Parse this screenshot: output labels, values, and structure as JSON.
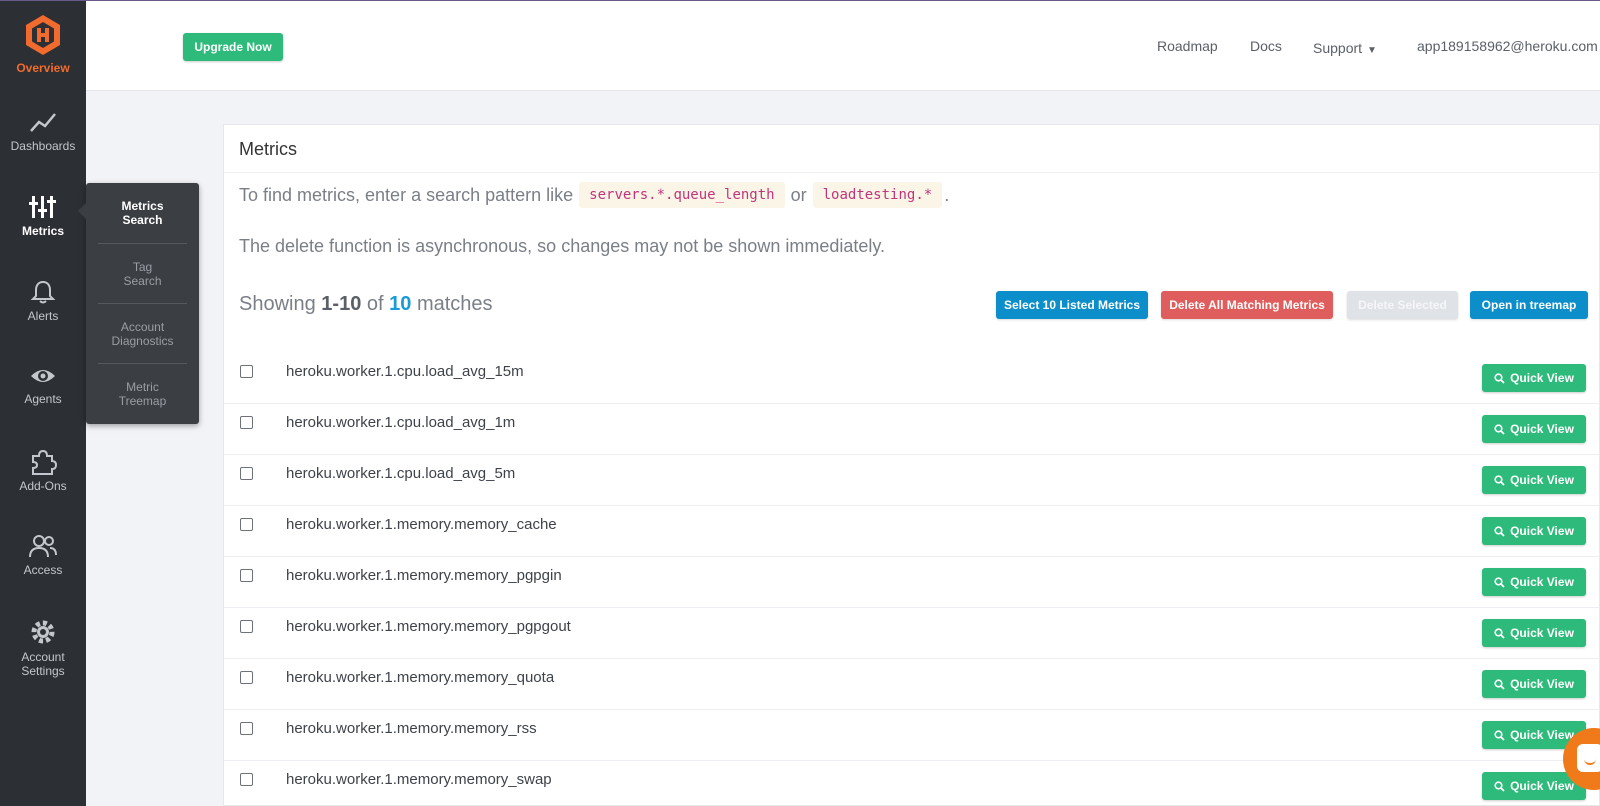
{
  "sidebar": {
    "items": [
      {
        "label": "Overview",
        "icon": "hexagon-logo-icon"
      },
      {
        "label": "Dashboards",
        "icon": "line-chart-icon"
      },
      {
        "label": "Metrics",
        "icon": "metrics-bars-icon"
      },
      {
        "label": "Alerts",
        "icon": "bell-icon"
      },
      {
        "label": "Agents",
        "icon": "eye-icon"
      },
      {
        "label": "Add-Ons",
        "icon": "puzzle-icon"
      },
      {
        "label": "Access",
        "icon": "users-icon"
      },
      {
        "label": "Account\nSettings",
        "label_lines": [
          "Account",
          "Settings"
        ],
        "icon": "gear-icon"
      }
    ]
  },
  "flyout": {
    "items": [
      {
        "lines": [
          "Metrics",
          "Search"
        ]
      },
      {
        "lines": [
          "Tag",
          "Search"
        ]
      },
      {
        "lines": [
          "Account",
          "Diagnostics"
        ]
      },
      {
        "lines": [
          "Metric",
          "Treemap"
        ]
      }
    ]
  },
  "header": {
    "upgrade_label": "Upgrade Now",
    "roadmap": "Roadmap",
    "docs": "Docs",
    "support": "Support",
    "email": "app189158962@heroku.com"
  },
  "card": {
    "title": "Metrics",
    "hint_prefix": "To find metrics, enter a search pattern like",
    "hint_code1": "servers.*.queue_length",
    "hint_or": "or",
    "hint_code2": "loadtesting.*",
    "hint_suffix": ".",
    "note": "The delete function is asynchronous, so changes may not be shown immediately.",
    "showing_prefix": "Showing",
    "showing_range": "1-10",
    "showing_of": "of",
    "showing_total": "10",
    "showing_suffix": "matches",
    "buttons": {
      "select": "Select 10 Listed Metrics",
      "delete_all": "Delete All Matching Metrics",
      "delete_selected": "Delete Selected",
      "treemap": "Open in treemap"
    },
    "quick_view": "Quick View",
    "metrics": [
      "heroku.worker.1.cpu.load_avg_15m",
      "heroku.worker.1.cpu.load_avg_1m",
      "heroku.worker.1.cpu.load_avg_5m",
      "heroku.worker.1.memory.memory_cache",
      "heroku.worker.1.memory.memory_pgpgin",
      "heroku.worker.1.memory.memory_pgpgout",
      "heroku.worker.1.memory.memory_quota",
      "heroku.worker.1.memory.memory_rss",
      "heroku.worker.1.memory.memory_swap"
    ]
  },
  "colors": {
    "sidebar_bg": "#2c2f33",
    "brand_orange": "#f06b2d",
    "green": "#2dba7a",
    "blue": "#0b8ec9",
    "red": "#e05d5d"
  }
}
